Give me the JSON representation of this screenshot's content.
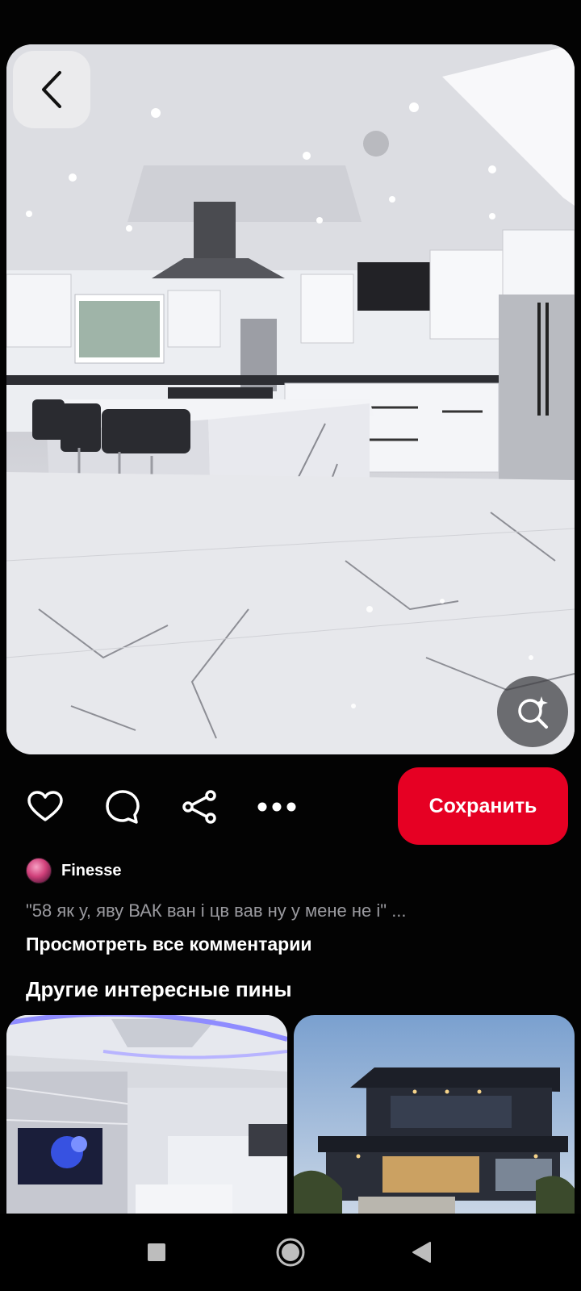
{
  "pin": {
    "image_description_icon": "kitchen-photo",
    "back_icon": "chevron-left-icon",
    "lens_icon": "visual-search-icon"
  },
  "actions": {
    "like_icon": "heart-icon",
    "comment_icon": "comment-icon",
    "share_icon": "share-icon",
    "more_icon": "more-dots-icon",
    "save_label": "Сохранить",
    "save_color": "#e60023"
  },
  "author": {
    "name": "Finesse"
  },
  "comments": {
    "preview": "\"58 як у, яву ВАК ван і цв вав ну у мене не і\" ...",
    "view_all": "Просмотреть все комментарии"
  },
  "related": {
    "title": "Другие интересные пины"
  },
  "navbar": {
    "recents_icon": "square-icon",
    "home_icon": "circle-icon",
    "back_icon": "triangle-back-icon"
  }
}
